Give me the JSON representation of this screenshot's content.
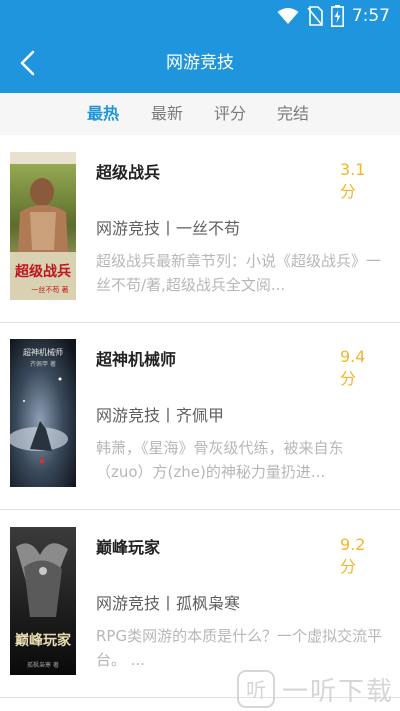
{
  "status_bar": {
    "time": "7:57",
    "icons": [
      "wifi-icon",
      "no-sim-icon",
      "battery-charging-icon"
    ]
  },
  "header": {
    "title": "网游竞技",
    "back_icon": "chevron-left-icon"
  },
  "tabs": [
    {
      "label": "最热",
      "active": true
    },
    {
      "label": "最新",
      "active": false
    },
    {
      "label": "评分",
      "active": false
    },
    {
      "label": "完结",
      "active": false
    }
  ],
  "books": [
    {
      "title": "超级战兵",
      "score": "3.1",
      "score_unit": "分",
      "meta": "网游竞技丨一丝不苟",
      "desc": "超级战兵最新章节列：小说《超级战兵》一丝不苟/著,超级战兵全文阅...",
      "cover_text": "超级战兵",
      "cover_subtext": "一丝不苟 著"
    },
    {
      "title": "超神机械师",
      "score": "9.4",
      "score_unit": "分",
      "meta": "网游竞技丨齐佩甲",
      "desc": "韩萧，《星海》骨灰级代练，被来自东（zuo）方(zhe)的神秘力量扔进...",
      "cover_text": "超神机械师",
      "cover_subtext": "齐佩甲 著"
    },
    {
      "title": "巅峰玩家",
      "score": "9.2",
      "score_unit": "分",
      "meta": "网游竞技丨孤枫枭寒",
      "desc": "RPG类网游的本质是什么？一个虚拟交流平台。 ...",
      "cover_text": "巅峰玩家",
      "cover_subtext": "孤枫枭寒 著"
    }
  ],
  "watermark": {
    "text": "一听下载",
    "logo_char": "听"
  },
  "colors": {
    "primary": "#1e95dd",
    "score": "#f3b62c",
    "tab_bg": "#f6f6f6"
  }
}
